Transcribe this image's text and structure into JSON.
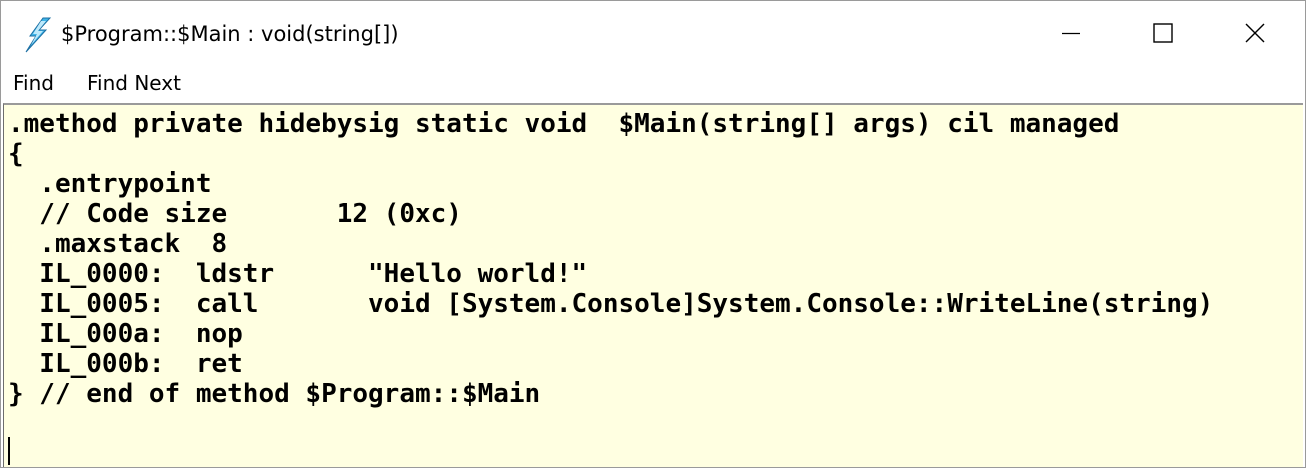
{
  "window": {
    "title": "$Program::$Main : void(string[])",
    "icon": "lightning-bolt-icon"
  },
  "menubar": {
    "find_label": "Find",
    "find_next_label": "Find Next"
  },
  "editor": {
    "background": "#ffffe1",
    "lines": [
      ".method private hidebysig static void  $Main(string[] args) cil managed",
      "{",
      "  .entrypoint",
      "  // Code size       12 (0xc)",
      "  .maxstack  8",
      "  IL_0000:  ldstr      \"Hello world!\"",
      "  IL_0005:  call       void [System.Console]System.Console::WriteLine(string)",
      "  IL_000a:  nop",
      "  IL_000b:  ret",
      "} // end of method $Program::$Main",
      ""
    ]
  }
}
